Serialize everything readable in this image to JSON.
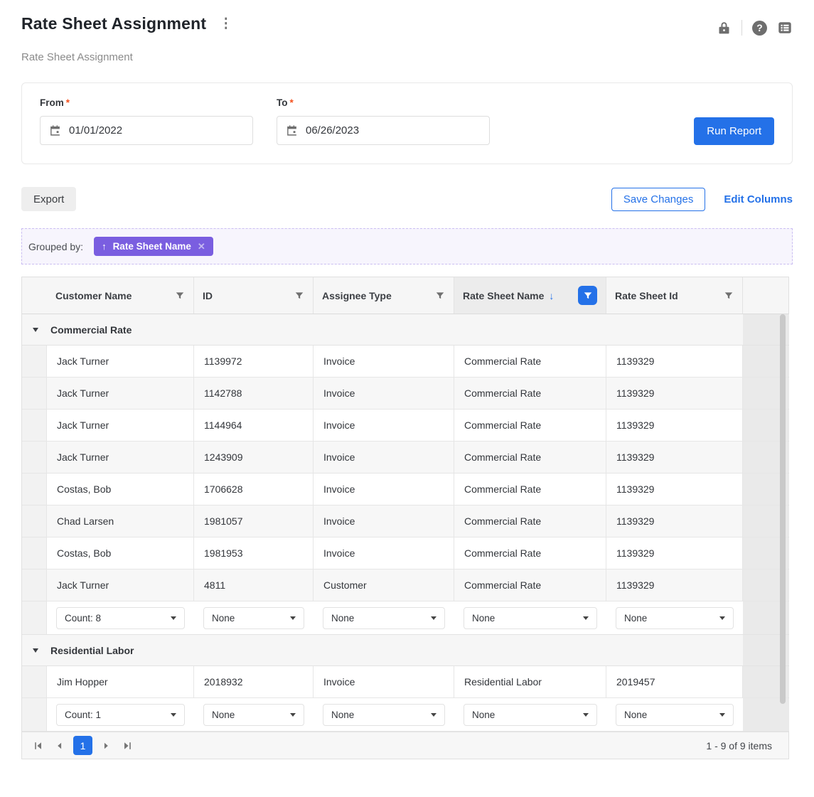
{
  "header": {
    "title": "Rate Sheet Assignment",
    "subtitle": "Rate Sheet Assignment",
    "icons": [
      "kebab-menu",
      "lock",
      "help",
      "list-menu"
    ]
  },
  "filters": {
    "from": {
      "label": "From",
      "required": "*",
      "value": "01/01/2022"
    },
    "to": {
      "label": "To",
      "required": "*",
      "value": "06/26/2023"
    },
    "run_report": "Run Report"
  },
  "actions": {
    "export": "Export",
    "save_changes": "Save Changes",
    "edit_columns": "Edit Columns"
  },
  "group_bar": {
    "label": "Grouped by:",
    "chip_label": "Rate Sheet Name",
    "chip_sort_icon": "arrow-up",
    "chip_remove_icon": "x"
  },
  "table": {
    "columns": [
      {
        "label": "Customer Name",
        "sorted": null,
        "filter_active": false
      },
      {
        "label": "ID",
        "sorted": null,
        "filter_active": false
      },
      {
        "label": "Assignee Type",
        "sorted": null,
        "filter_active": false
      },
      {
        "label": "Rate Sheet Name",
        "sorted": "desc",
        "filter_active": true
      },
      {
        "label": "Rate Sheet Id",
        "sorted": null,
        "filter_active": false
      }
    ],
    "groups": [
      {
        "name": "Commercial Rate",
        "rows": [
          [
            "Jack Turner",
            "1139972",
            "Invoice",
            "Commercial Rate",
            "1139329"
          ],
          [
            "Jack Turner",
            "1142788",
            "Invoice",
            "Commercial Rate",
            "1139329"
          ],
          [
            "Jack Turner",
            "1144964",
            "Invoice",
            "Commercial Rate",
            "1139329"
          ],
          [
            "Jack Turner",
            "1243909",
            "Invoice",
            "Commercial Rate",
            "1139329"
          ],
          [
            "Costas, Bob",
            "1706628",
            "Invoice",
            "Commercial Rate",
            "1139329"
          ],
          [
            "Chad Larsen",
            "1981057",
            "Invoice",
            "Commercial Rate",
            "1139329"
          ],
          [
            "Costas, Bob",
            "1981953",
            "Invoice",
            "Commercial Rate",
            "1139329"
          ],
          [
            "Jack Turner",
            "4811",
            "Customer",
            "Commercial Rate",
            "1139329"
          ]
        ],
        "aggregates": [
          "Count: 8",
          "None",
          "None",
          "None",
          "None"
        ]
      },
      {
        "name": "Residential Labor",
        "rows": [
          [
            "Jim Hopper",
            "2018932",
            "Invoice",
            "Residential Labor",
            "2019457"
          ]
        ],
        "aggregates": [
          "Count: 1",
          "None",
          "None",
          "None",
          "None"
        ]
      }
    ]
  },
  "pagination": {
    "current_page": "1",
    "summary": "1 - 9 of 9 items",
    "icons": [
      "first-page",
      "previous-page",
      "next-page",
      "last-page"
    ]
  },
  "colors": {
    "accent_blue": "#2471e8",
    "chip_purple": "#7a5ee0",
    "required_red": "#f4511e",
    "group_bar_bg": "#f7f5fd",
    "group_bar_border": "#cabdf2"
  }
}
